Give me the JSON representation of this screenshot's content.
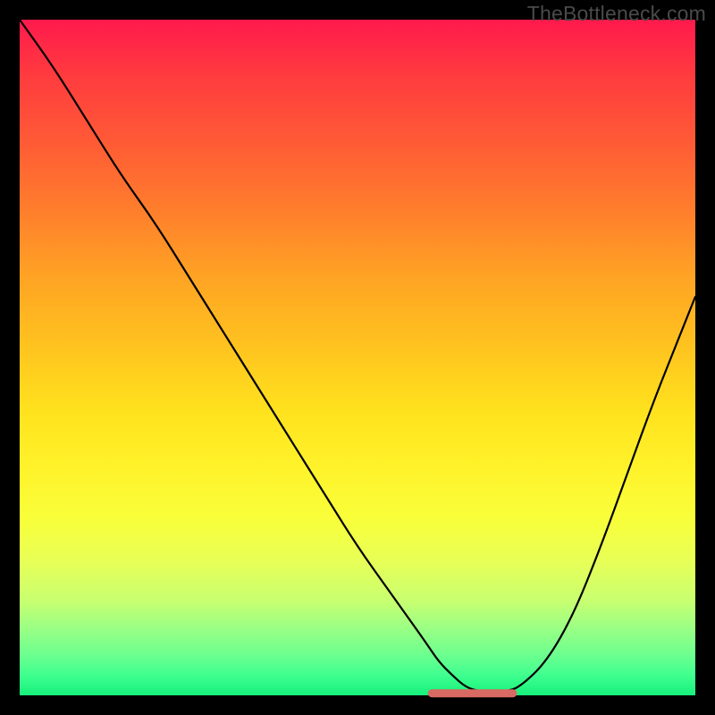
{
  "watermark": "TheBottleneck.com",
  "chart_data": {
    "type": "line",
    "title": "",
    "xlabel": "",
    "ylabel": "",
    "xlim": [
      0,
      100
    ],
    "ylim": [
      0,
      100
    ],
    "grid": false,
    "legend": false,
    "series": [
      {
        "name": "bottleneck-curve",
        "color": "#000000",
        "x": [
          0,
          5,
          10,
          15,
          20,
          25,
          30,
          35,
          40,
          45,
          50,
          55,
          60,
          62,
          64,
          66,
          68,
          70,
          72,
          74,
          78,
          82,
          86,
          90,
          94,
          98,
          100
        ],
        "values": [
          100,
          93,
          85,
          77,
          70,
          62,
          54,
          46,
          38,
          30,
          22,
          15,
          8,
          5,
          3,
          1.2,
          0.6,
          0.4,
          0.6,
          1.2,
          5,
          12,
          22,
          33,
          44,
          54,
          59
        ]
      }
    ],
    "annotations": [
      {
        "name": "optimal-flat-segment",
        "color": "#d86a63",
        "x_start": 61,
        "x_end": 73,
        "y": 0.3
      }
    ],
    "background_gradient": {
      "top": "#ff1a4d",
      "bottom": "#17f07c"
    }
  }
}
